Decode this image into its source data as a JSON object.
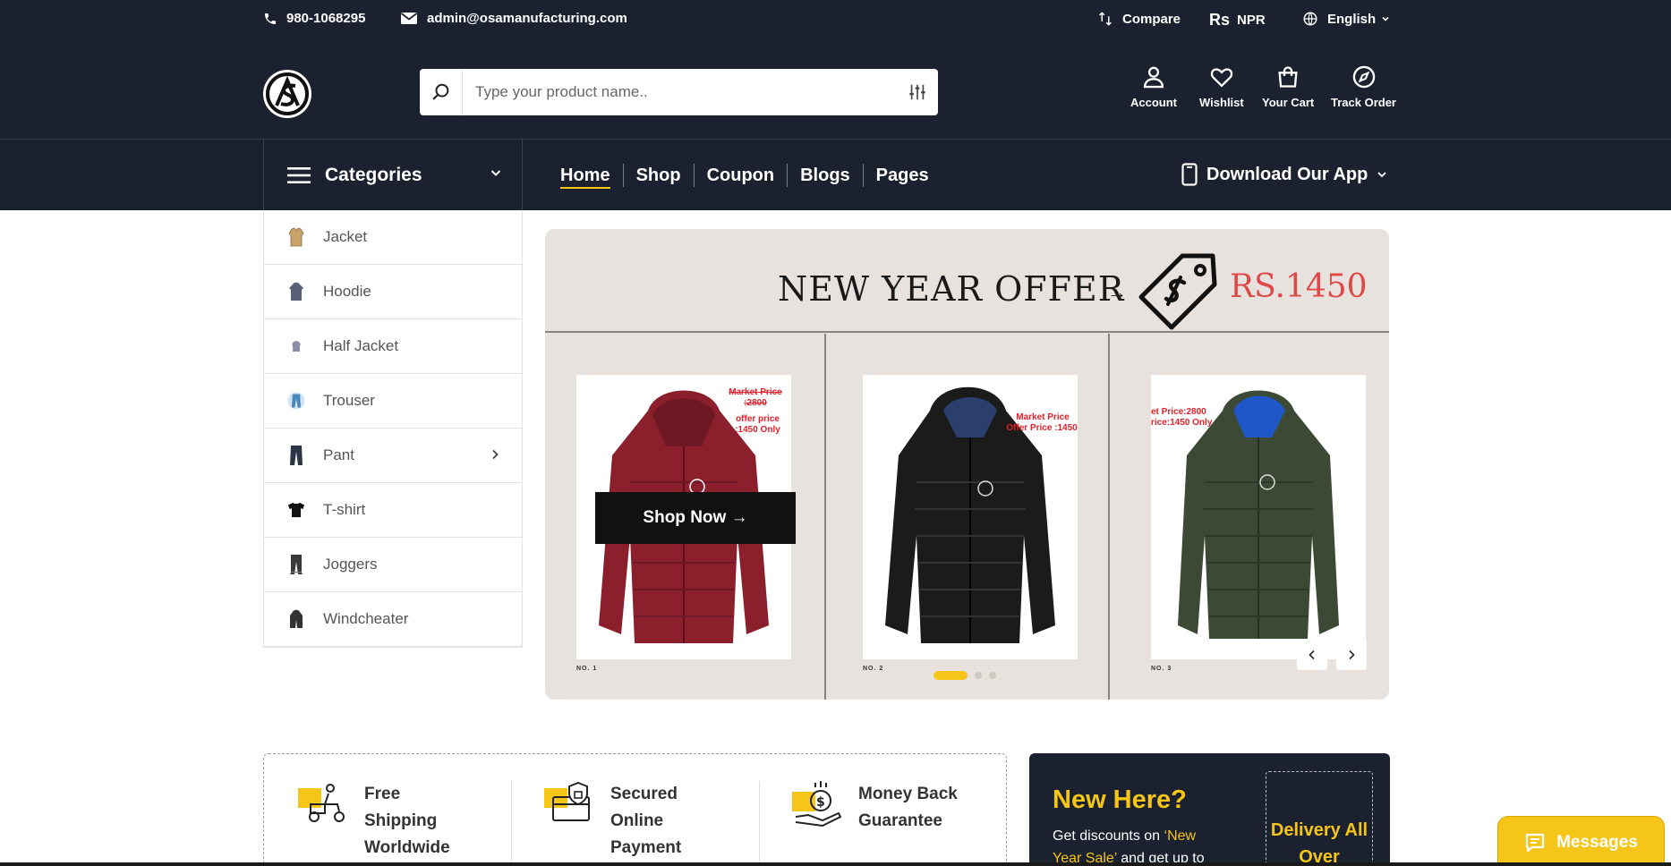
{
  "topbar": {
    "phone": "980-1068295",
    "email": "admin@osamanufacturing.com",
    "compare_label": "Compare",
    "currency_symbol": "Rs",
    "currency_code": "NPR",
    "language": "English"
  },
  "search": {
    "placeholder": "Type your product name.."
  },
  "header_actions": {
    "account": "Account",
    "wishlist": "Wishlist",
    "cart": "Your Cart",
    "track": "Track Order"
  },
  "nav": {
    "categories_label": "Categories",
    "links": [
      "Home",
      "Shop",
      "Coupon",
      "Blogs",
      "Pages"
    ],
    "active": "Home",
    "download_app": "Download Our App"
  },
  "categories": [
    {
      "label": "Jacket",
      "icon": "jacket-icon",
      "color": "#c9a36a"
    },
    {
      "label": "Hoodie",
      "icon": "hoodie-icon",
      "color": "#5a5f78"
    },
    {
      "label": "Half Jacket",
      "icon": "half-jacket-icon",
      "color": "#8a8fa8"
    },
    {
      "label": "Trouser",
      "icon": "trouser-icon",
      "color": "#4a86b8"
    },
    {
      "label": "Pant",
      "icon": "pant-icon",
      "color": "#2b3545",
      "has_submenu": true
    },
    {
      "label": "T-shirt",
      "icon": "tshirt-icon",
      "color": "#111111"
    },
    {
      "label": "Joggers",
      "icon": "joggers-icon",
      "color": "#3a3a3a"
    },
    {
      "label": "Windcheater",
      "icon": "windcheater-icon",
      "color": "#333333"
    }
  ],
  "hero": {
    "title": "NEW YEAR OFFER",
    "arrow": "→",
    "price": "RS.1450",
    "shop_now": "Shop Now →",
    "products": [
      {
        "no": "NO. 1",
        "color": "#8b1f2c",
        "tag_line1": "Market Price :2800",
        "tag_line2": "offer price :1450 Only"
      },
      {
        "no": "NO. 2",
        "color": "#1b1b1b",
        "tag_line1": "Market Price",
        "tag_line2": "Offer Price :1450"
      },
      {
        "no": "NO. 3",
        "color": "#3c4a35",
        "tag_line1": "et Price:2800",
        "tag_line2": "rice:1450 Only"
      }
    ]
  },
  "features": [
    {
      "label": "Free Shipping Worldwide",
      "icon": "delivery-scooter-icon"
    },
    {
      "label": "Secured Online Payment",
      "icon": "secure-payment-icon"
    },
    {
      "label": "Money Back Guarantee",
      "icon": "money-back-icon"
    }
  ],
  "new_here": {
    "title": "New Here?",
    "text_before": "Get discounts on ",
    "highlight": "‘New Year Sale’",
    "text_after": " and get up to",
    "delivery": "Delivery All Over"
  },
  "messages": {
    "label": "Messages"
  },
  "colors": {
    "header_bg": "#1c2130",
    "accent": "#f5c518",
    "price_red": "#e04848",
    "banner_bg": "#e8e2de"
  }
}
